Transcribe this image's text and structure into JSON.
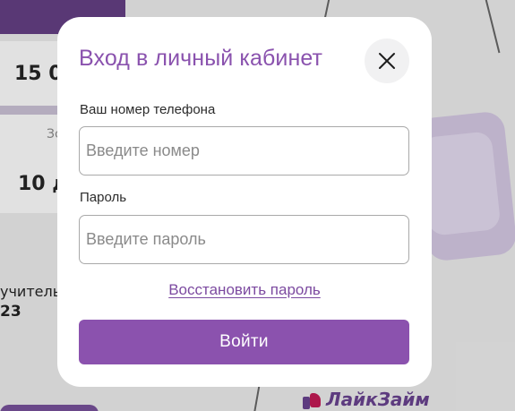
{
  "background": {
    "card_amount": "15 0",
    "card_small_label": "Зс",
    "card_term": "10 д",
    "info_label": "учитель",
    "info_value": "23",
    "logo_text": "ЛайкЗайм"
  },
  "modal": {
    "title": "Вход в личный кабинет",
    "close_icon": "close-icon",
    "phone_label": "Ваш номер телефона",
    "phone_placeholder": "Введите номер",
    "phone_value": "",
    "password_label": "Пароль",
    "password_placeholder": "Введите пароль",
    "password_value": "",
    "restore_link": "Восстановить пароль",
    "submit_label": "Войти"
  },
  "colors": {
    "accent": "#8b52ae",
    "title": "#8a52ae",
    "link": "#7c4aa0",
    "modal_bg": "#ffffff",
    "page_dim": "#d7d7d7"
  }
}
